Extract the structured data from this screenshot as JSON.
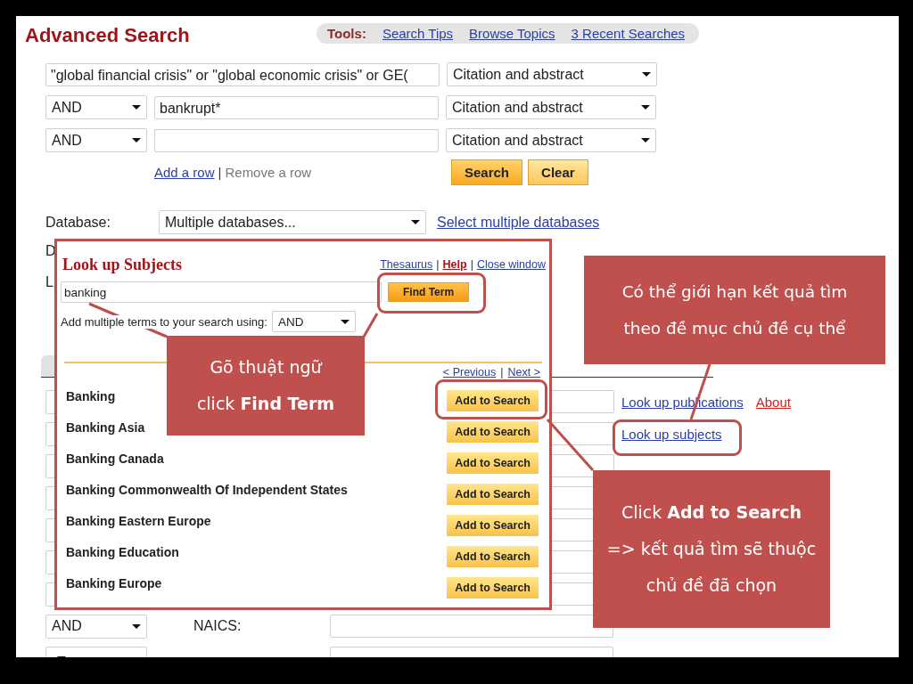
{
  "page_title": "Advanced Search",
  "tools": {
    "label": "Tools:",
    "links": [
      "Search Tips",
      "Browse Topics",
      "3 Recent Searches"
    ]
  },
  "search_rows": [
    {
      "kind": "first",
      "query": "\"global financial crisis\" or \"global economic crisis\" or GE(",
      "field": "Citation and abstract"
    },
    {
      "kind": "joined",
      "operator": "AND",
      "query": "bankrupt*",
      "field": "Citation and abstract"
    },
    {
      "kind": "joined",
      "operator": "AND",
      "field": "Citation and abstract"
    }
  ],
  "row_links": {
    "add": "Add a row",
    "separator": "|",
    "remove": "Remove a row"
  },
  "buttons": [
    "Search",
    "Clear"
  ],
  "database": {
    "label": "Database:",
    "value": "Multiple databases...",
    "link": "Select multiple databases"
  },
  "cut_labels": [
    "D",
    "L"
  ],
  "lookup_links": [
    {
      "kind": "link",
      "text": "Look up publications"
    },
    {
      "kind": "alert",
      "text": "About"
    },
    {
      "kind": "link",
      "text": "Look up subjects"
    }
  ],
  "naics_row": {
    "operator": "AND",
    "label": "NAICS:"
  },
  "popup": {
    "title": "Look up Subjects",
    "links": [
      {
        "kind": "link",
        "text": "Thesaurus"
      },
      {
        "kind": "help",
        "text": "Help"
      },
      {
        "kind": "link",
        "text": "Close window"
      }
    ],
    "separator": "|",
    "term": "banking",
    "find_button": "Find Term",
    "combine_label": "Add multiple terms to your search using:",
    "combine_value": "AND",
    "pager": {
      "previous": "< Previous",
      "separator": "|",
      "next": "Next >"
    },
    "results": [
      {
        "term": "Banking",
        "button": "Add to Search"
      },
      {
        "term": "Banking Asia",
        "button": "Add to Search"
      },
      {
        "term": "Banking Canada",
        "button": "Add to Search"
      },
      {
        "term": "Banking Commonwealth Of Independent States",
        "button": "Add to Search"
      },
      {
        "term": "Banking Eastern Europe",
        "button": "Add to Search"
      },
      {
        "term": "Banking Education",
        "button": "Add to Search"
      },
      {
        "term": "Banking Europe",
        "button": "Add to Search"
      }
    ]
  },
  "callouts": [
    {
      "lines": [
        "Gõ thuật ngữ",
        "click **Find Term**"
      ]
    },
    {
      "lines": [
        "Có thể giới hạn kết quả tìm",
        "theo đề mục chủ đề cụ thể"
      ]
    },
    {
      "lines": [
        "Click **Add to Search**",
        "=> kết quả tìm sẽ thuộc",
        "chủ đề đã chọn"
      ]
    }
  ]
}
